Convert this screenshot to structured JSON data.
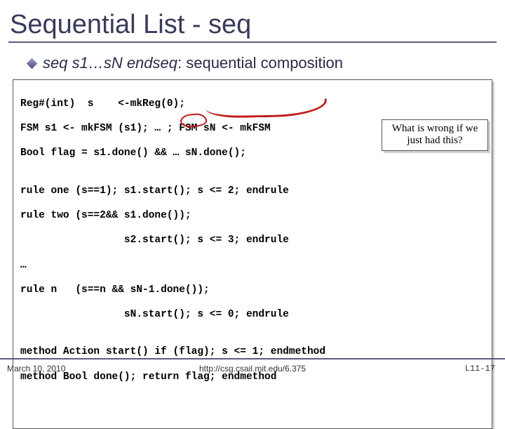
{
  "title": "Sequential List - seq",
  "bullet": {
    "prefix": "seq s1…sN endseq",
    "rest": ": sequential composition"
  },
  "code": {
    "l1": "Reg#(int)  s    <-mkReg(0);",
    "l2": "FSM s1 <- mkFSM (s1); … ; FSM sN <- mkFSM",
    "l3": "Bool flag = s1.done() && … sN.done();",
    "l4": "",
    "l5": "rule one (s==1); s1.start(); s <= 2; endrule",
    "l6": "rule two (s==2&& s1.done());",
    "l7": "                 s2.start(); s <= 3; endrule",
    "l8": "…",
    "l9": "rule n   (s==n && sN-1.done());",
    "l10": "                 sN.start(); s <= 0; endrule",
    "l11": "",
    "l12": "method Action start() if (flag); s <= 1; endmethod",
    "l13": "method Bool done(); return flag; endmethod"
  },
  "callout": "What is wrong if we just had this?",
  "footer": {
    "left": "March 10, 2010",
    "mid": "http://csg.csail.mit.edu/6.375",
    "right": "L11-17"
  }
}
